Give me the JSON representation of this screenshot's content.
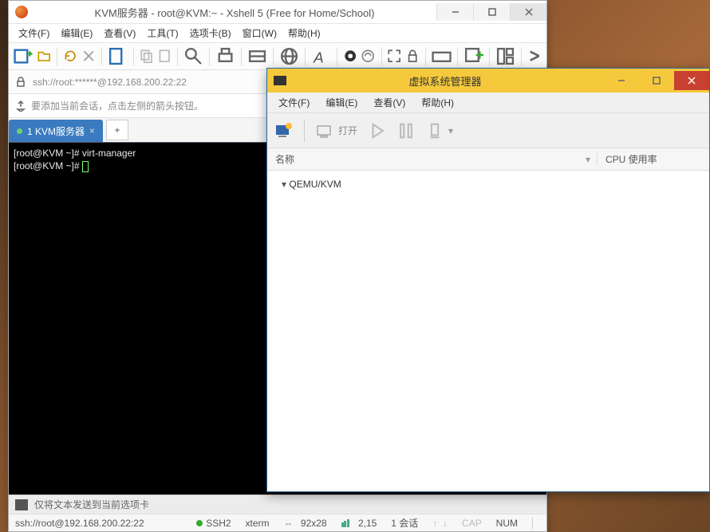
{
  "xshell": {
    "title": "KVM服务器 - root@KVM:~ - Xshell 5 (Free for Home/School)",
    "menu": [
      "文件(F)",
      "编辑(E)",
      "查看(V)",
      "工具(T)",
      "选项卡(B)",
      "窗口(W)",
      "帮助(H)"
    ],
    "address": "ssh://root:******@192.168.200.22:22",
    "hint": "要添加当前会话，点击左侧的箭头按钮。",
    "tab_label": "1 KVM服务器",
    "terminal_line1": "[root@KVM ~]# virt-manager",
    "terminal_line2": "[root@KVM ~]# ",
    "bottom_hint": "仅将文本发送到当前选项卡",
    "status": {
      "addr": "ssh://root@192.168.200.22:22",
      "proto": "SSH2",
      "term": "xterm",
      "size": "92x28",
      "pos": "2,15",
      "sess": "1 会话",
      "cap": "CAP",
      "num": "NUM"
    }
  },
  "vmgr": {
    "title": "虚拟系统管理器",
    "menu": [
      "文件(F)",
      "编辑(E)",
      "查看(V)",
      "帮助(H)"
    ],
    "open_label": "打开",
    "col_name": "名称",
    "col_cpu": "CPU 使用率",
    "row1": "QEMU/KVM"
  }
}
